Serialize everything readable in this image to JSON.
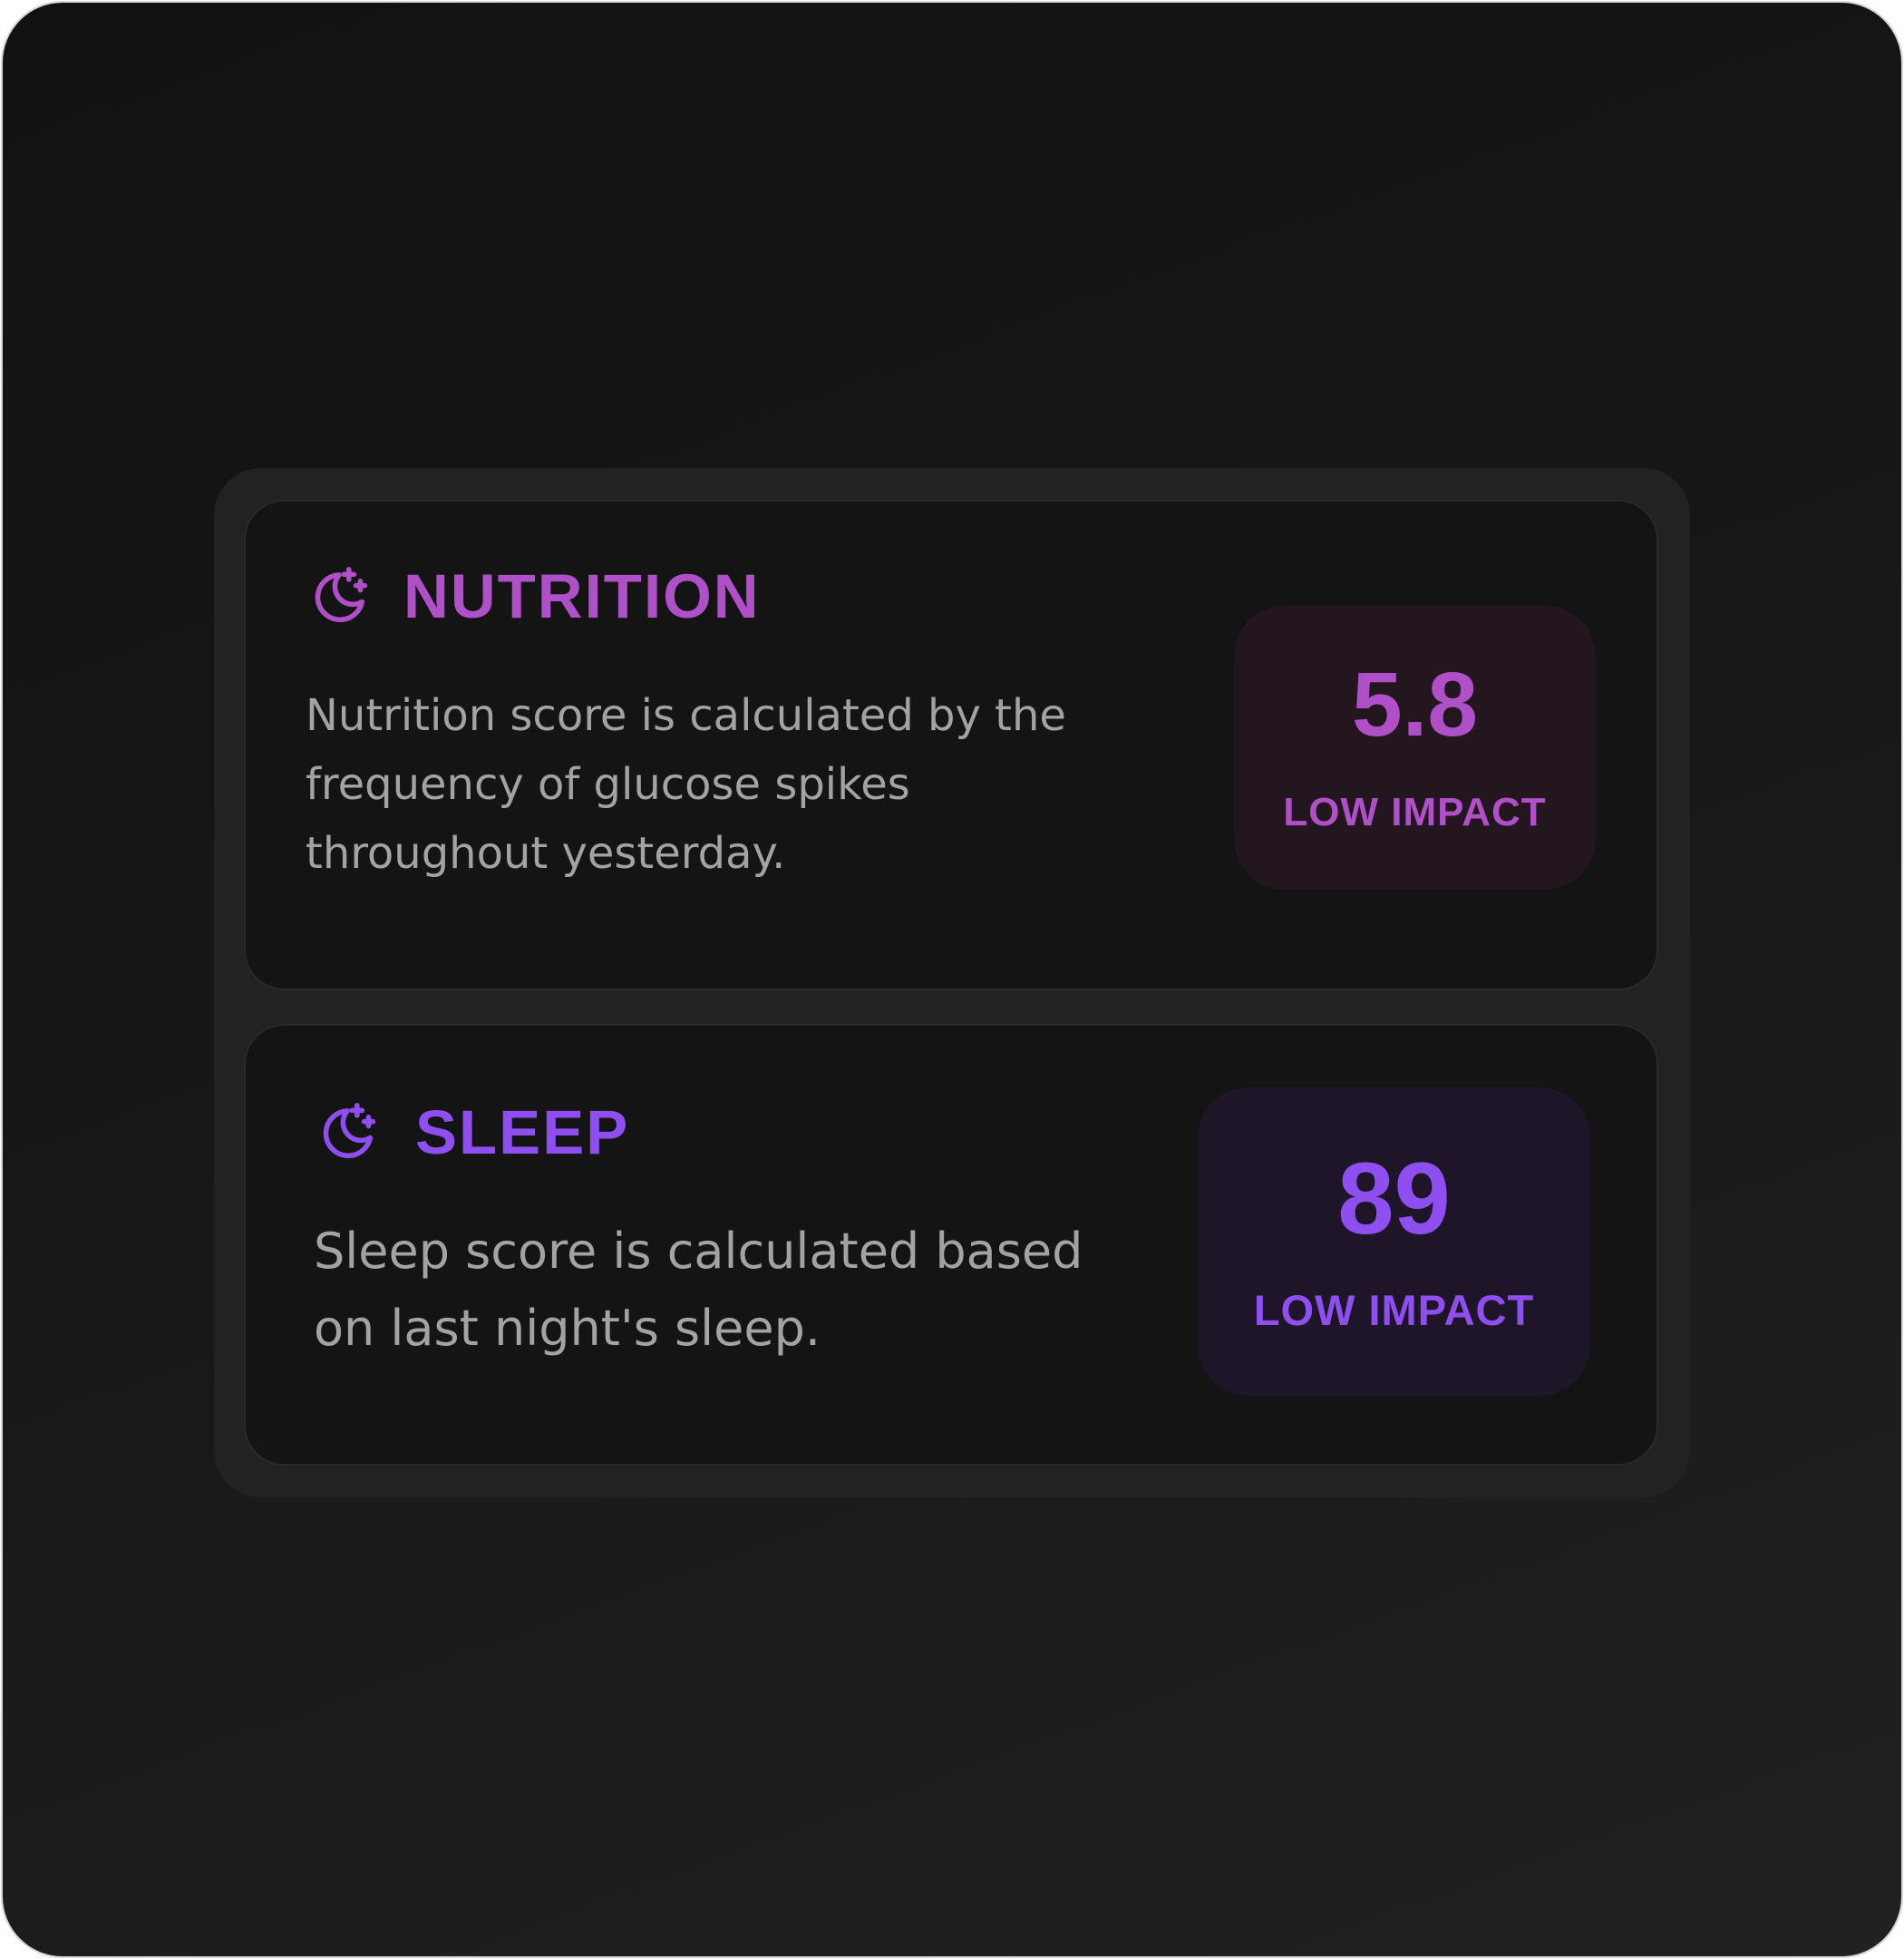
{
  "colors": {
    "nutrition_accent": "#b050c9",
    "sleep_accent": "#8f4ff0",
    "card_background": "#141414",
    "panel_background": "#222222",
    "description_text": "#a3a3a3"
  },
  "cards": {
    "nutrition": {
      "icon": "moon-stars-icon",
      "title": "NUTRITION",
      "description": "Nutrition score is calculated by the frequency of glucose spikes throughout yesterday.",
      "score": "5.8",
      "impact": "LOW IMPACT"
    },
    "sleep": {
      "icon": "moon-stars-icon",
      "title": "SLEEP",
      "description": "Sleep score is calculated based on last night's sleep.",
      "score": "89",
      "impact": "LOW IMPACT"
    }
  }
}
